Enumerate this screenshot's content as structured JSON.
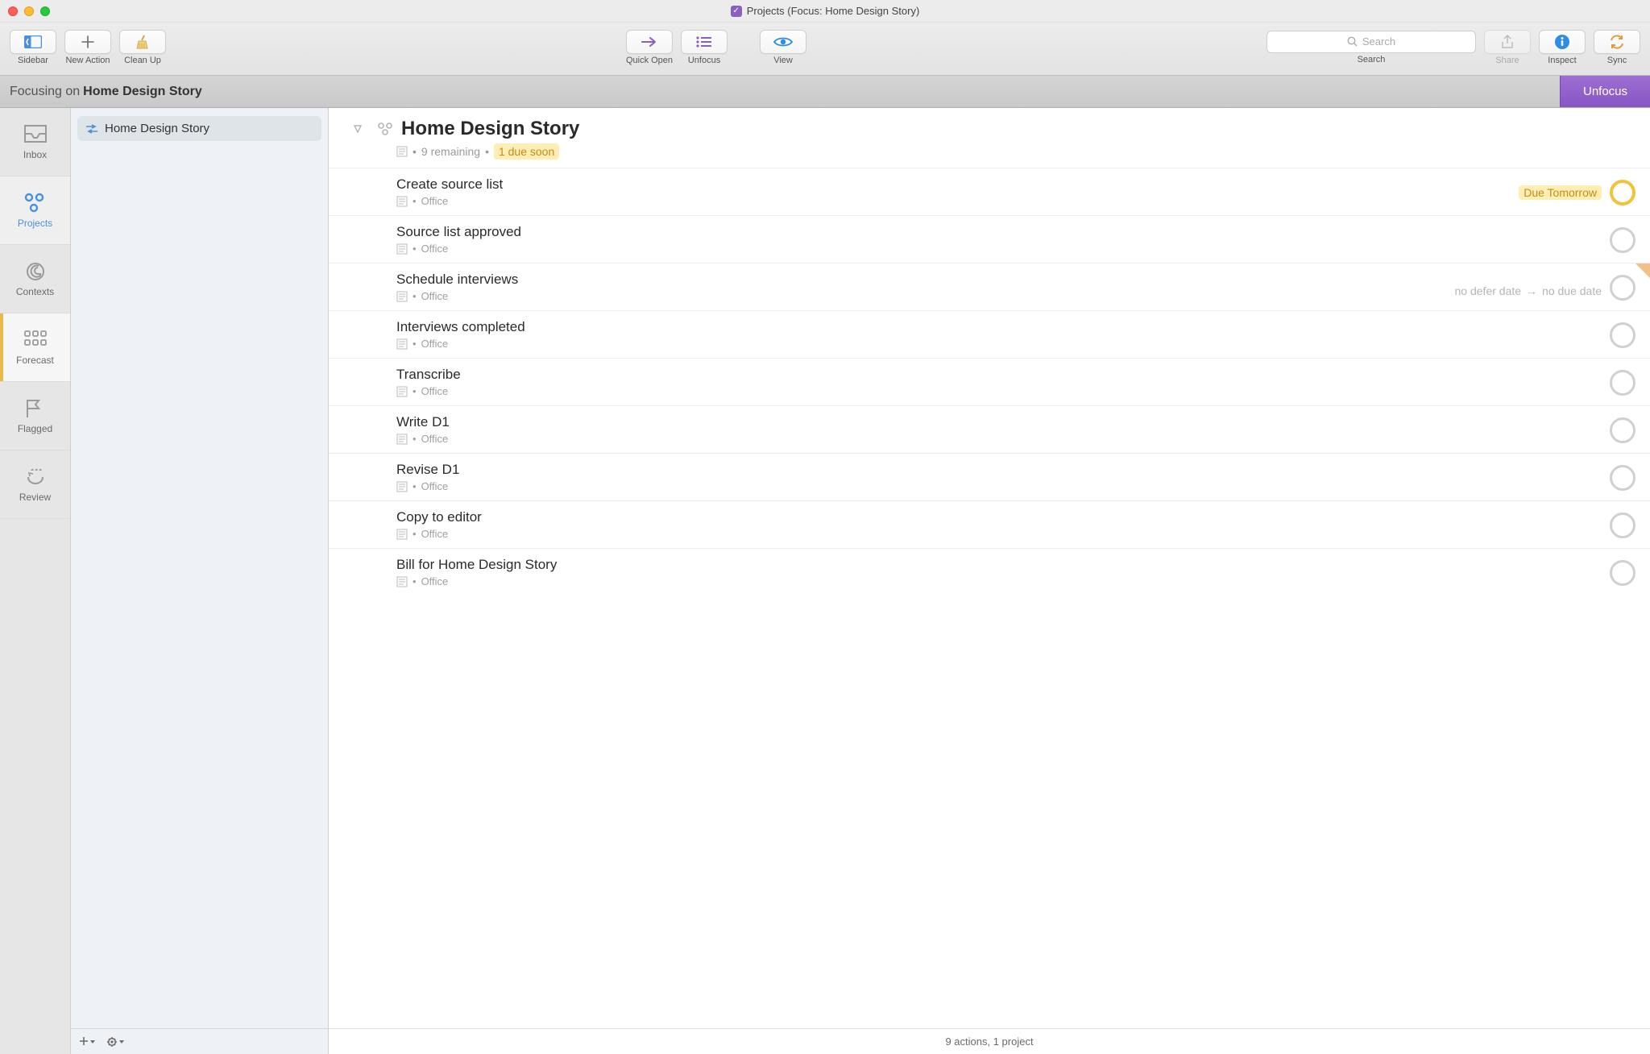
{
  "window": {
    "title": "Projects (Focus: Home Design Story)"
  },
  "toolbar": {
    "sidebar_label": "Sidebar",
    "new_action_label": "New Action",
    "clean_up_label": "Clean Up",
    "quick_open_label": "Quick Open",
    "unfocus_label": "Unfocus",
    "view_label": "View",
    "search_label": "Search",
    "search_placeholder": "Search",
    "share_label": "Share",
    "inspect_label": "Inspect",
    "sync_label": "Sync"
  },
  "focusbar": {
    "prefix": "Focusing on",
    "name": "Home Design Story",
    "unfocus_button": "Unfocus"
  },
  "rail": {
    "items": [
      {
        "label": "Inbox"
      },
      {
        "label": "Projects"
      },
      {
        "label": "Contexts"
      },
      {
        "label": "Forecast"
      },
      {
        "label": "Flagged"
      },
      {
        "label": "Review"
      }
    ]
  },
  "sidebar": {
    "project_name": "Home Design Story"
  },
  "detail": {
    "title": "Home Design Story",
    "remaining_text": "9 remaining",
    "due_soon_text": "1 due soon",
    "tasks": [
      {
        "title": "Create source list",
        "context": "Office",
        "due_badge": "Due Tomorrow",
        "status": "due"
      },
      {
        "title": "Source list approved",
        "context": "Office"
      },
      {
        "title": "Schedule interviews",
        "context": "Office",
        "right_info_left": "no defer date",
        "right_info_right": "no due date",
        "flagged_corner": true
      },
      {
        "title": "Interviews completed",
        "context": "Office"
      },
      {
        "title": "Transcribe",
        "context": "Office"
      },
      {
        "title": "Write D1",
        "context": "Office"
      },
      {
        "title": "Revise D1",
        "context": "Office"
      },
      {
        "title": "Copy to editor",
        "context": "Office"
      },
      {
        "title": "Bill for Home Design Story",
        "context": "Office"
      }
    ]
  },
  "statusbar": {
    "text": "9 actions, 1 project"
  }
}
